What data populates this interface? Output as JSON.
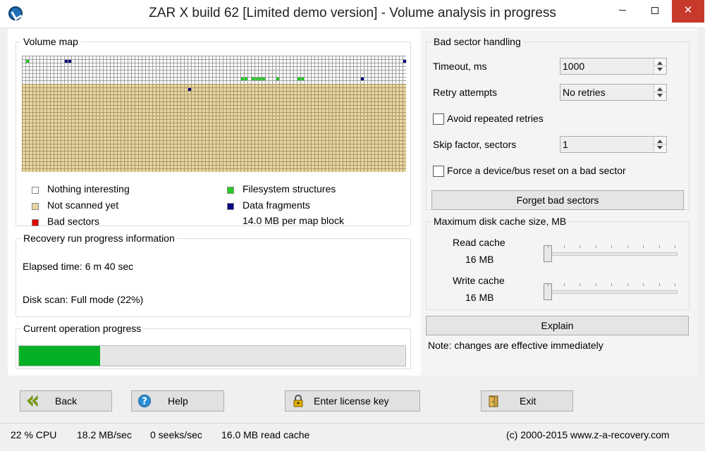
{
  "window": {
    "title": "ZAR X build 62 [Limited demo version] - Volume analysis in progress",
    "minimize_glyph": "",
    "close_glyph": "✕"
  },
  "volume_map": {
    "title": "Volume map",
    "legend": {
      "nothing_interesting": "Nothing interesting",
      "not_scanned": "Not scanned yet",
      "bad_sectors": "Bad sectors",
      "filesystem": "Filesystem structures",
      "data_fragments": "Data fragments",
      "per_block": "14.0 MB per map block"
    },
    "colors": {
      "nothing": "#ffffff",
      "not_scanned": "#e8d5a2",
      "bad": "#e00000",
      "filesystem": "#22cc22",
      "fragments": "#000080"
    },
    "scanned_fraction": 0.22
  },
  "progress_info": {
    "title": "Recovery run progress information",
    "elapsed": "Elapsed time: 6 m 40 sec",
    "disk_scan": "Disk scan: Full mode (22%)"
  },
  "current_progress": {
    "title": "Current operation progress",
    "fraction": 0.21
  },
  "bad_sector": {
    "title": "Bad sector handling",
    "timeout_label": "Timeout, ms",
    "timeout_value": "1000",
    "retry_label": "Retry attempts",
    "retry_value": "No retries",
    "avoid_label": "Avoid repeated retries",
    "avoid_checked": false,
    "skip_label": "Skip factor, sectors",
    "skip_value": "1",
    "reset_label": "Force a device/bus reset on a bad sector",
    "reset_checked": false,
    "forget_button": "Forget bad sectors"
  },
  "cache": {
    "title": "Maximum disk cache size, MB",
    "read_label": "Read cache",
    "read_value": "16 MB",
    "read_level": 0,
    "write_label": "Write cache",
    "write_value": "16 MB",
    "write_level": 0,
    "explain_button": "Explain",
    "note": "Note: changes are effective immediately"
  },
  "buttons": {
    "back": "Back",
    "help": "Help",
    "license": "Enter license key",
    "exit": "Exit"
  },
  "status": {
    "cpu": "22 % CPU",
    "speed": "18.2 MB/sec",
    "seeks": "0 seeks/sec",
    "cache": "16.0 MB read cache",
    "copyright": "(c) 2000-2015 www.z-a-recovery.com"
  }
}
